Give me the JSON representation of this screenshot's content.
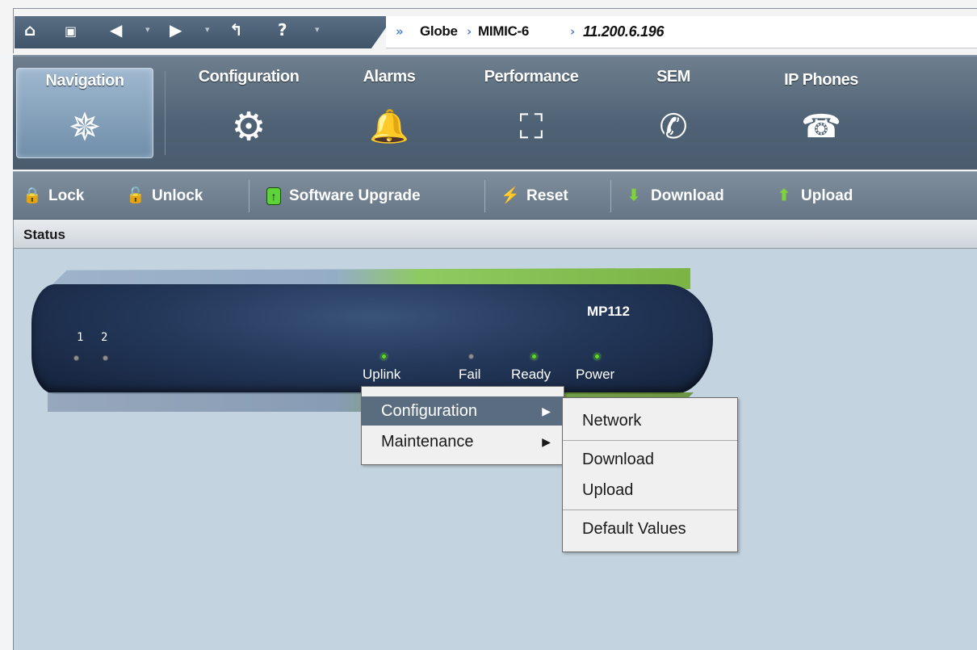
{
  "toolbar_icons": [
    {
      "name": "home-icon",
      "glyph": "⌂"
    },
    {
      "name": "globe-folder-icon",
      "glyph": "▣"
    },
    {
      "name": "back-icon",
      "glyph": "🡄"
    },
    {
      "name": "forward-icon",
      "glyph": "🡆"
    },
    {
      "name": "up-level-icon",
      "glyph": "↰"
    },
    {
      "name": "help-icon",
      "glyph": "?"
    }
  ],
  "breadcrumb": {
    "items": [
      "Globe",
      "MIMIC-6",
      "11.200.6.196"
    ]
  },
  "nav": {
    "tabs": [
      {
        "label": "Navigation",
        "icon": "compass-star-icon",
        "glyph": "✵",
        "active": true
      },
      {
        "label": "Configuration",
        "icon": "gear-icon",
        "glyph": "⚙"
      },
      {
        "label": "Alarms",
        "icon": "bell-icon",
        "glyph": "🔔"
      },
      {
        "label": "Performance",
        "icon": "chart-icon",
        "glyph": "⛶"
      },
      {
        "label": "SEM",
        "icon": "phone-handset-icon",
        "glyph": "✆"
      },
      {
        "label": "IP Phones",
        "icon": "desk-phone-icon",
        "glyph": "☎"
      }
    ]
  },
  "actions": {
    "lock": "Lock",
    "unlock": "Unlock",
    "software_upgrade": "Software Upgrade",
    "reset": "Reset",
    "download": "Download",
    "upload": "Upload"
  },
  "status": {
    "title": "Status"
  },
  "device": {
    "model": "MP112",
    "ports": [
      "1",
      "2"
    ],
    "leds": [
      {
        "label": "Uplink",
        "state": "on"
      },
      {
        "label": "Fail",
        "state": "off"
      },
      {
        "label": "Ready",
        "state": "on"
      },
      {
        "label": "Power",
        "state": "on"
      }
    ]
  },
  "context_menu": {
    "items": [
      "Configuration",
      "Maintenance"
    ],
    "highlighted": "Configuration"
  },
  "submenu": {
    "items": [
      "Network",
      "Download",
      "Upload",
      "Default Values"
    ]
  },
  "colors": {
    "accent": "#5a6d80",
    "led_on": "#63d43a",
    "content_bg": "#c3d4e0"
  }
}
